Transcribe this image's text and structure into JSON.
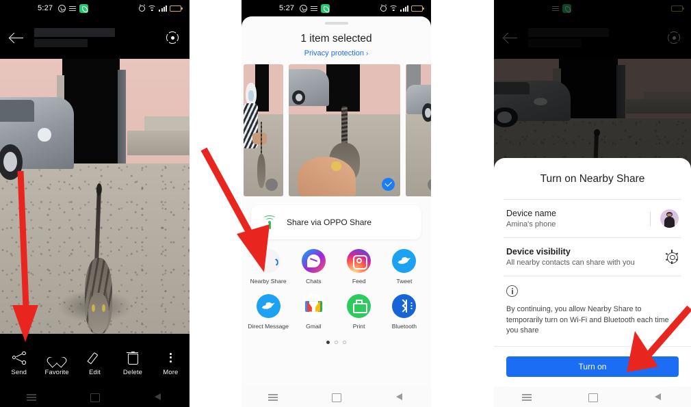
{
  "statusbar": {
    "time": "5:27",
    "left_icons": [
      "whatsapp-icon",
      "menu-lines-icon",
      "phone-call-icon"
    ],
    "right_icons": [
      "alarm-icon",
      "wifi-icon",
      "signal-icon",
      "battery-icon"
    ]
  },
  "panel1": {
    "name": "photo-viewer",
    "header": {
      "back_icon": "back-arrow-icon",
      "title_redacted": true,
      "lens_icon": "google-lens-icon"
    },
    "photo_description": "Tabby cat standing on concrete yard, silver car and garage in background",
    "toolbar": [
      {
        "icon": "share-icon",
        "label": "Send"
      },
      {
        "icon": "heart-icon",
        "label": "Favorite"
      },
      {
        "icon": "pencil-icon",
        "label": "Edit"
      },
      {
        "icon": "trash-icon",
        "label": "Delete"
      },
      {
        "icon": "more-dots-icon",
        "label": "More"
      }
    ],
    "navbar": [
      "recents-icon",
      "home-icon",
      "back-icon"
    ]
  },
  "panel2": {
    "name": "share-sheet",
    "handle": "drag-handle",
    "title": "1 item selected",
    "privacy_link": "Privacy protection",
    "privacy_chevron": "›",
    "thumbnails": [
      {
        "name": "thumb-person-with-cat",
        "selected": false,
        "description": "Person in white headscarf petting cat"
      },
      {
        "name": "thumb-cat-with-hand",
        "selected": true,
        "description": "Cat approaching an outstretched hand with gold ring"
      },
      {
        "name": "thumb-silver-car",
        "selected": false,
        "description": "Silver car parked on concrete"
      }
    ],
    "oppo_share": {
      "icon": "oppo-share-broadcast-icon",
      "label": "Share via OPPO Share"
    },
    "apps": [
      {
        "icon": "nearby-share-icon",
        "label": "Nearby Share"
      },
      {
        "icon": "messenger-icon",
        "label": "Chats"
      },
      {
        "icon": "instagram-icon",
        "label": "Feed"
      },
      {
        "icon": "twitter-icon",
        "label": "Tweet"
      },
      {
        "icon": "twitter-dm-icon",
        "label": "Direct Message"
      },
      {
        "icon": "gmail-icon",
        "label": "Gmail"
      },
      {
        "icon": "print-icon",
        "label": "Print"
      },
      {
        "icon": "bluetooth-icon",
        "label": "Bluetooth"
      }
    ],
    "page_dots": {
      "count": 3,
      "active_index": 0
    },
    "navbar": [
      "recents-icon",
      "home-icon",
      "back-icon"
    ]
  },
  "panel3": {
    "name": "nearby-share-dialog",
    "header": {
      "back_icon": "back-arrow-icon",
      "lens_icon": "google-lens-icon"
    },
    "dialog_title": "Turn on Nearby Share",
    "device_name": {
      "label": "Device name",
      "value": "Amina's phone",
      "avatar": "user-avatar"
    },
    "device_visibility": {
      "label": "Device visibility",
      "value": "All nearby contacts can share with you",
      "settings_icon": "gear-icon"
    },
    "info": {
      "icon": "info-icon",
      "text": "By continuing, you allow Nearby Share to temporarily turn on Wi-Fi and Bluetooth each time you share"
    },
    "primary_button": "Turn on",
    "navbar": [
      "recents-icon",
      "home-icon",
      "back-icon"
    ]
  },
  "annotations": {
    "color": "#e8251f",
    "arrows": [
      {
        "name": "arrow-to-send",
        "points_to": "Send"
      },
      {
        "name": "arrow-to-nearby-share",
        "points_to": "Nearby Share"
      },
      {
        "name": "arrow-to-turn-on",
        "points_to": "Turn on"
      }
    ]
  },
  "colors": {
    "accent_blue": "#1b6ef3",
    "link_blue": "#1b6ef3",
    "oppo_green": "#2fbf5f",
    "annotation_red": "#e8251f",
    "sheet_bg": "#fbfbfb"
  }
}
